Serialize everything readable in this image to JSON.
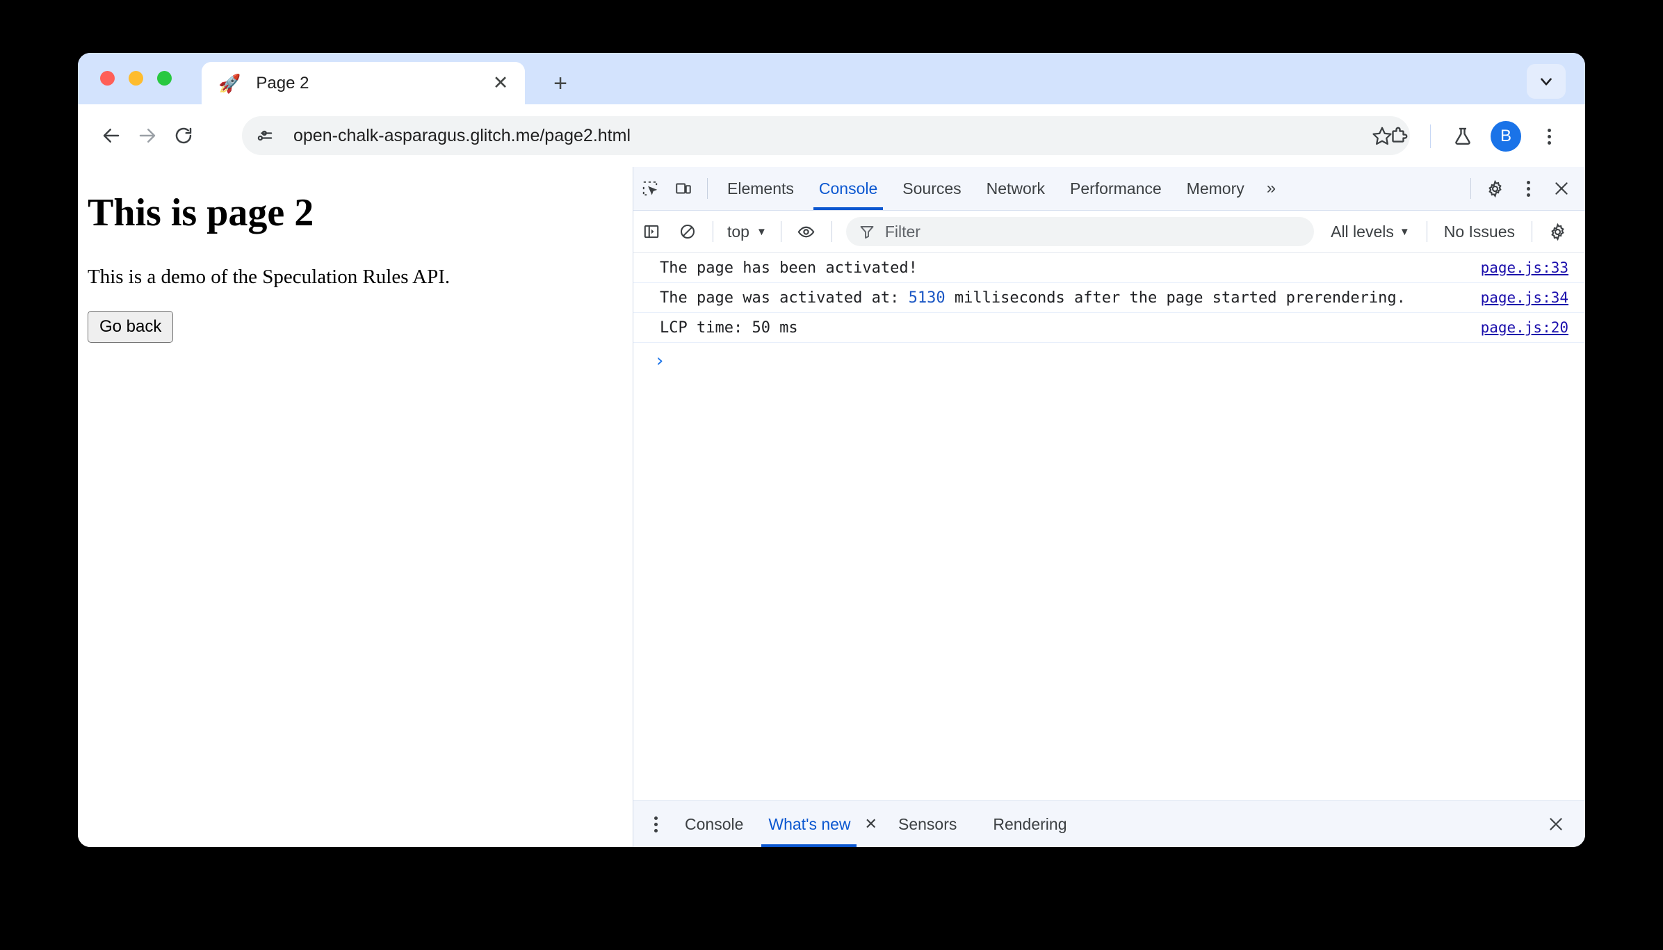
{
  "browser": {
    "tab": {
      "favicon": "rocket-icon",
      "title": "Page 2",
      "close": "✕"
    },
    "newtab_label": "+",
    "tabsearch_icon": "chevron-down-icon",
    "omnibox": {
      "url": "open-chalk-asparagus.glitch.me/page2.html",
      "site_info_icon": "site-settings-icon",
      "bookmark_icon": "star-icon"
    },
    "nav": {
      "back": "back-arrow-icon",
      "forward": "forward-arrow-icon",
      "reload": "reload-icon"
    },
    "actions": {
      "extensions": "extensions-puzzle-icon",
      "labs": "flask-icon",
      "profile_initial": "B",
      "menu": "three-dot-menu-icon"
    }
  },
  "page": {
    "heading": "This is page 2",
    "paragraph": "This is a demo of the Speculation Rules API.",
    "button_label": "Go back"
  },
  "devtools": {
    "left_icons": {
      "inspect": "inspect-element-icon",
      "device": "device-toolbar-icon"
    },
    "tabs": [
      {
        "label": "Elements",
        "active": false
      },
      {
        "label": "Console",
        "active": true
      },
      {
        "label": "Sources",
        "active": false
      },
      {
        "label": "Network",
        "active": false
      },
      {
        "label": "Performance",
        "active": false
      },
      {
        "label": "Memory",
        "active": false
      }
    ],
    "overflow_label": "»",
    "right_icons": {
      "settings": "gear-icon",
      "more": "three-dot-menu-icon",
      "close": "close-icon"
    },
    "console_toolbar": {
      "sidebar_toggle": "console-sidebar-icon",
      "clear": "clear-console-icon",
      "context": "top",
      "context_caret": "▼",
      "eye": "live-expression-icon",
      "filter_placeholder": "Filter",
      "filter_icon": "filter-icon",
      "levels": "All levels",
      "levels_caret": "▼",
      "issues": "No Issues",
      "settings": "gear-icon"
    },
    "messages": [
      {
        "text": "The page has been activated!",
        "prefix": "",
        "number": "",
        "suffix": "",
        "source": "page.js:33"
      },
      {
        "text": "",
        "prefix": "The page was activated at: ",
        "number": "5130",
        "suffix": "  milliseconds after the page started prerendering.",
        "source": "page.js:34"
      },
      {
        "text": "LCP time: 50 ms",
        "prefix": "",
        "number": "",
        "suffix": "",
        "source": "page.js:20"
      }
    ],
    "prompt_glyph": "›",
    "drawer": {
      "menu_icon": "three-dot-menu-icon",
      "tabs": [
        {
          "label": "Console",
          "active": false,
          "closable": false
        },
        {
          "label": "What's new",
          "active": true,
          "closable": true
        },
        {
          "label": "Sensors",
          "active": false,
          "closable": false
        },
        {
          "label": "Rendering",
          "active": false,
          "closable": false
        }
      ],
      "tab_close_glyph": "✕",
      "close_glyph": "✕"
    }
  },
  "colors": {
    "accent": "#0b57d0",
    "link": "#1a0dab",
    "tabstrip": "#d3e3fd",
    "avatar": "#1a73e8"
  }
}
